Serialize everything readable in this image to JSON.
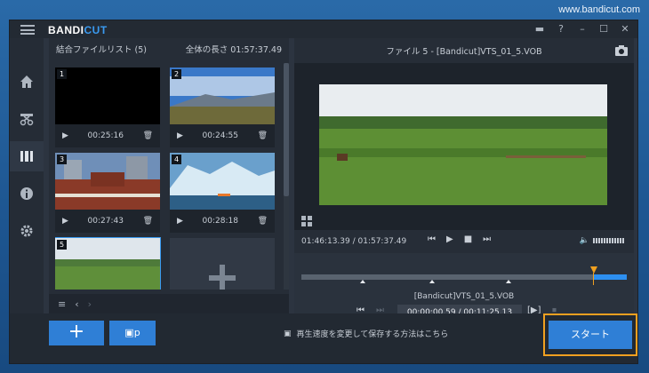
{
  "watermark": "www.bandicut.com",
  "app": {
    "logo_main": "BANDI",
    "logo_accent": "CUT"
  },
  "window_buttons": [
    "folder-icon",
    "help-icon",
    "minimize-icon",
    "maximize-icon",
    "close-icon"
  ],
  "window_button_glyphs": [
    "▬",
    "?",
    "–",
    "☐",
    "✕"
  ],
  "sidebar": [
    {
      "name": "home-icon"
    },
    {
      "name": "cut-icon"
    },
    {
      "name": "merge-icon",
      "active": true
    },
    {
      "name": "info-icon"
    },
    {
      "name": "settings-icon"
    }
  ],
  "join_list": {
    "title": "結合ファイルリスト (5)",
    "total_length": "全体の長さ 01:57:37.49",
    "clips": [
      {
        "num": "1",
        "duration": "00:25:16"
      },
      {
        "num": "2",
        "duration": "00:24:55"
      },
      {
        "num": "3",
        "duration": "00:27:43"
      },
      {
        "num": "4",
        "duration": "00:28:18"
      },
      {
        "num": "5",
        "duration": ""
      }
    ]
  },
  "preview": {
    "file_title": "ファイル 5 - [Bandicut]VTS_01_5.VOB",
    "time_readout": "01:46:13.39 / 01:57:37.49",
    "file_label": "[Bandicut]VTS_01_5.VOB",
    "trim_time": "00:00:00.59 / 00:11:25.13"
  },
  "bottom": {
    "add_label": "+",
    "mode_label": "▣p",
    "hint": "再生速度を変更して保存する方法はこちら",
    "start_label": "スタート"
  },
  "colors": {
    "accent": "#2f7fd6",
    "highlight": "#f0a020"
  }
}
